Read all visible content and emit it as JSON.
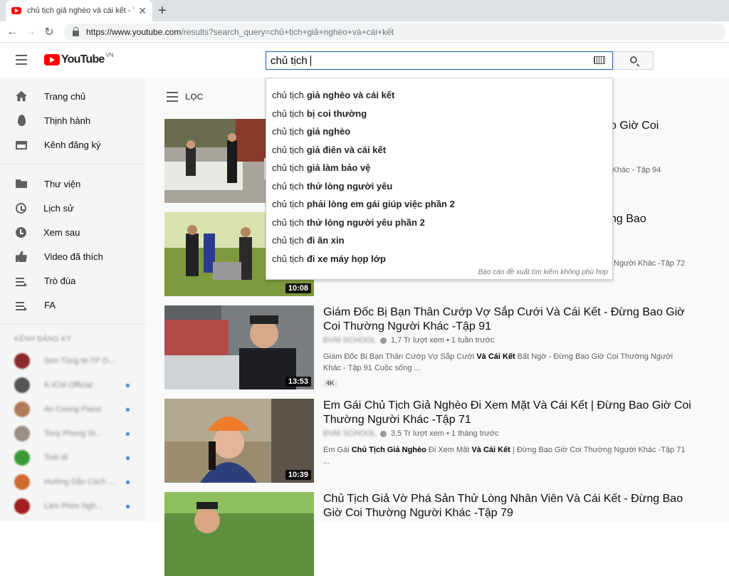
{
  "browser": {
    "tab_title": "chủ tịch giả nghèo và cái kết - Yo",
    "tab_close": "✕",
    "new_tab": "+",
    "back": "←",
    "forward": "→",
    "reload": "↻",
    "url_host": "https://www.youtube.com",
    "url_rest": "/results?search_query=chủ+tịch+giả+nghèo+và+cái+kết"
  },
  "masthead": {
    "logo_text": "YouTube",
    "country_code": "VN",
    "search_value": "chủ tịch"
  },
  "sidebar": {
    "items": [
      {
        "label": "Trang chủ",
        "icon": "home-icon"
      },
      {
        "label": "Thịnh hành",
        "icon": "trending-icon"
      },
      {
        "label": "Kênh đăng ký",
        "icon": "subscriptions-icon"
      },
      {
        "label": "Thư viện",
        "icon": "library-icon"
      },
      {
        "label": "Lịch sử",
        "icon": "history-icon"
      },
      {
        "label": "Xem sau",
        "icon": "watch-later-icon"
      },
      {
        "label": "Video đã thích",
        "icon": "liked-icon"
      },
      {
        "label": "Trò đùa",
        "icon": "playlist-icon"
      },
      {
        "label": "FA",
        "icon": "playlist-icon"
      }
    ],
    "subs_heading": "KÊNH ĐĂNG KÝ",
    "subscriptions": [
      {
        "name": "Sơn Tùng M-TP O...",
        "avatar_color": "#8b2a2a",
        "new": false
      },
      {
        "name": "K-ICM Official",
        "avatar_color": "#555555",
        "new": true
      },
      {
        "name": "An Coong Piano",
        "avatar_color": "#b07a5a",
        "new": true
      },
      {
        "name": "Tony Phong St...",
        "avatar_color": "#9a8f86",
        "new": true
      },
      {
        "name": "Tinh tế",
        "avatar_color": "#3a9a3a",
        "new": true
      },
      {
        "name": "Hướng Dẫn Cách ...",
        "avatar_color": "#d06a30",
        "new": true
      },
      {
        "name": "Làm Phim Ngh...",
        "avatar_color": "#a02020",
        "new": true
      }
    ]
  },
  "main": {
    "filter_label": "LỌC",
    "videos": [
      {
        "title": "Giám Đốc Bị Bạn Thân Cướp Vợ Sắp Cưới Và Cái Kết - Đừng Bao Giờ Coi Thường Người Khác -Tập 91",
        "channel": "ĐVM SCHOOL",
        "meta": "1,7 Tr lượt xem • 1 tuần trước",
        "desc_pre": "Giám Đốc Bị Bạn Thân Cướp Vợ Sắp Cưới ",
        "desc_bold": "Và Cái Kết",
        "desc_post": " Bất Ngờ - Đừng Bao Giờ Coi Thường Người Khác - Tập 91 Cuộc sống ...",
        "badge": "4K",
        "duration": "13:53"
      },
      {
        "title": "Em Gái Chủ Tịch Giả Nghèo Đi Xem Mặt Và Cái Kết | Đừng Bao Giờ Coi Thường Người Khác -Tập 71",
        "channel": "ĐVM SCHOOL",
        "meta": "3,5 Tr lượt xem • 1 tháng trước",
        "desc_pre": "Em Gái ",
        "desc_bold": "Chủ Tịch Giả Nghèo",
        "desc_mid": " Đi Xem Mặt ",
        "desc_bold2": "Và Cái Kết",
        "desc_post": " | Đừng Bao Giờ Coi Thường Người Khác -Tập 71 ...",
        "duration": "10:39"
      },
      {
        "title": "Chủ Tịch Giả Vờ Phá Sản Thử Lòng Nhân Viên Và Cái Kết - Đừng Bao Giờ Coi Thường Người Khác -Tập 79"
      }
    ],
    "hidden_partials": {
      "v1_title_tail": "o Giờ Coi",
      "v1_meta_tail": "i Khác - Tập 94",
      "v2_title_tail": "ng Bao",
      "v2_meta_tail": "Người Khác -Tập 72",
      "v2_duration": "10:08"
    }
  },
  "suggestions": {
    "typed": "chủ tịch",
    "items": [
      "giả nghèo và cái kết",
      "bị coi thường",
      "giả nghèo",
      "giả điên và cái kết",
      "giả làm bảo vệ",
      "thử lòng người yêu",
      "phải lòng em gái giúp việc phần 2",
      "thử lòng người yêu phần 2",
      "đi ăn xin",
      "đi xe máy họp lớp"
    ],
    "report_text": "Báo cáo đề xuất tìm kiếm không phù hợp"
  }
}
